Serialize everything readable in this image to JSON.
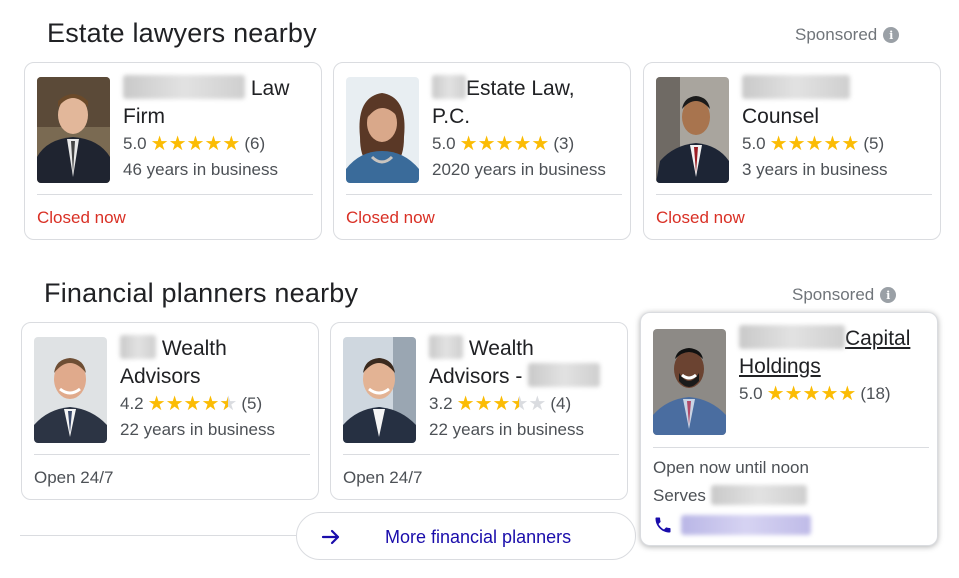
{
  "estate": {
    "title": "Estate lawyers nearby",
    "sponsored": "Sponsored",
    "cards": [
      {
        "name_suffix": "Law",
        "name_line2": "Firm",
        "rating": "5.0",
        "reviews": "(6)",
        "years": "46 years in business",
        "status": "Closed now",
        "stars": 5
      },
      {
        "name_suffix": "Estate Law,",
        "name_line2": "P.C.",
        "rating": "5.0",
        "reviews": "(3)",
        "years": "2020 years in business",
        "status": "Closed now",
        "stars": 5
      },
      {
        "name_line2": "Counsel",
        "rating": "5.0",
        "reviews": "(5)",
        "years": "3 years in business",
        "status": "Closed now",
        "stars": 5
      }
    ]
  },
  "financial": {
    "title": "Financial planners nearby",
    "sponsored": "Sponsored",
    "cards": [
      {
        "name_suffix": "Wealth",
        "name_line2": "Advisors",
        "rating": "4.2",
        "reviews": "(5)",
        "years": "22 years in business",
        "status": "Open 24/7",
        "stars": 4.2
      },
      {
        "name_suffix": "Wealth",
        "name_line2": "Advisors -",
        "rating": "3.2",
        "reviews": "(4)",
        "years": "22 years in business",
        "status": "Open 24/7",
        "stars": 3.2
      },
      {
        "name_suffix": "Capital",
        "name_line2": "Holdings",
        "rating": "5.0",
        "reviews": "(18)",
        "status": "Open now until noon",
        "serves": "Serves",
        "stars": 5
      }
    ],
    "more_label": "More financial planners"
  },
  "icons": {
    "info": "info-icon",
    "arrow": "arrow-right-icon",
    "phone": "phone-icon",
    "star": "star-icon"
  },
  "colors": {
    "star": "#fbbc04",
    "closed": "#d93025",
    "link": "#1a0dab"
  }
}
